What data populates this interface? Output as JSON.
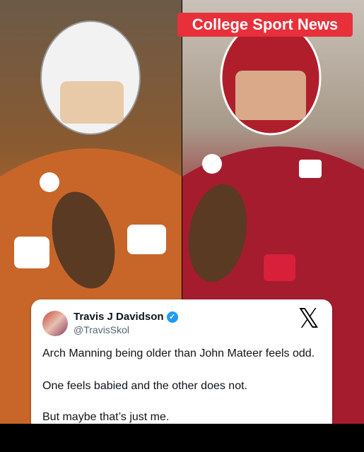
{
  "badge": {
    "text": "College Sport News"
  },
  "tweet": {
    "name": "Travis J Davidson",
    "handle": "@TravisSkol",
    "lines": [
      "Arch Manning being older than John Mateer feels odd.",
      "One feels babied and the other does not.",
      "But maybe that’s just me."
    ]
  },
  "colors": {
    "badge": "#e8303a",
    "verified": "#1d9bf0"
  }
}
